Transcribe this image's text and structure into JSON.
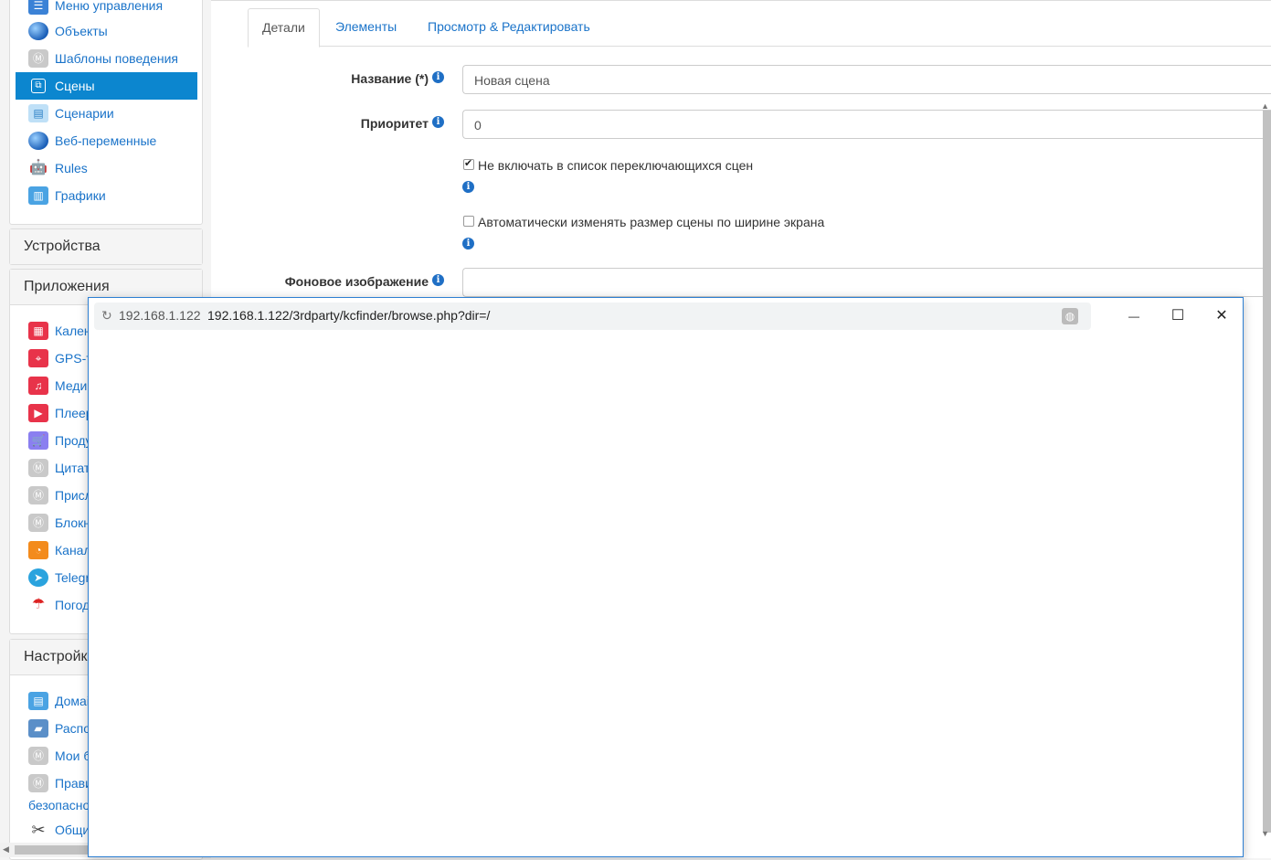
{
  "sidebar": {
    "top_items": [
      {
        "label": "Меню управления",
        "icon": "menu-icon"
      },
      {
        "label": "Объекты",
        "icon": "globe-icon"
      },
      {
        "label": "Шаблоны поведения",
        "icon": "module-icon"
      },
      {
        "label": "Сцены",
        "icon": "scenes-icon",
        "active": true
      },
      {
        "label": "Сценарии",
        "icon": "scripts-icon"
      },
      {
        "label": "Веб-переменные",
        "icon": "web-globe-icon"
      },
      {
        "label": "Rules",
        "icon": "robot-icon"
      },
      {
        "label": "Графики",
        "icon": "chart-icon"
      }
    ],
    "devices_title": "Устройства",
    "apps_title": "Приложения",
    "app_items": [
      {
        "label": "Кален",
        "icon": "calendar-icon"
      },
      {
        "label": "GPS-т",
        "icon": "gps-icon"
      },
      {
        "label": "Меди",
        "icon": "music-icon"
      },
      {
        "label": "Плеер",
        "icon": "play-icon"
      },
      {
        "label": "Проду",
        "icon": "cart-icon"
      },
      {
        "label": "Цитат",
        "icon": "module-icon"
      },
      {
        "label": "Присл",
        "icon": "module-icon"
      },
      {
        "label": "Блокн",
        "icon": "module-icon"
      },
      {
        "label": "Канал",
        "icon": "rss-icon"
      },
      {
        "label": "Telegr",
        "icon": "telegram-icon"
      },
      {
        "label": "Погод",
        "icon": "umbrella-icon"
      }
    ],
    "settings_title": "Настройк",
    "settings_items": [
      {
        "label": "Домаі",
        "icon": "document-icon"
      },
      {
        "label": "Распо",
        "icon": "folder-icon"
      },
      {
        "label": "Мои б",
        "icon": "module-icon"
      },
      {
        "label": "Прави",
        "icon": "module-icon"
      },
      {
        "label": "Общи",
        "icon": "tools-icon"
      }
    ],
    "settings_wrap_text": "безопасно"
  },
  "tabs": {
    "details": "Детали",
    "elements": "Элементы",
    "view_edit": "Просмотр & Редактировать"
  },
  "form": {
    "name_label": "Название (*)",
    "name_value": "Новая сцена",
    "priority_label": "Приоритет",
    "priority_value": "0",
    "exclude_label": "Не включать в список переключающихся сцен",
    "exclude_checked": true,
    "autoresize_label": "Автоматически изменять размер сцены по ширине экрана",
    "autoresize_checked": false,
    "background_label": "Фоновое изображение",
    "background_value": ""
  },
  "popup": {
    "host": "192.168.1.122",
    "url": "192.168.1.122/3rdparty/kcfinder/browse.php?dir=/",
    "minimize": "—",
    "maximize": "☐",
    "close": "✕"
  }
}
